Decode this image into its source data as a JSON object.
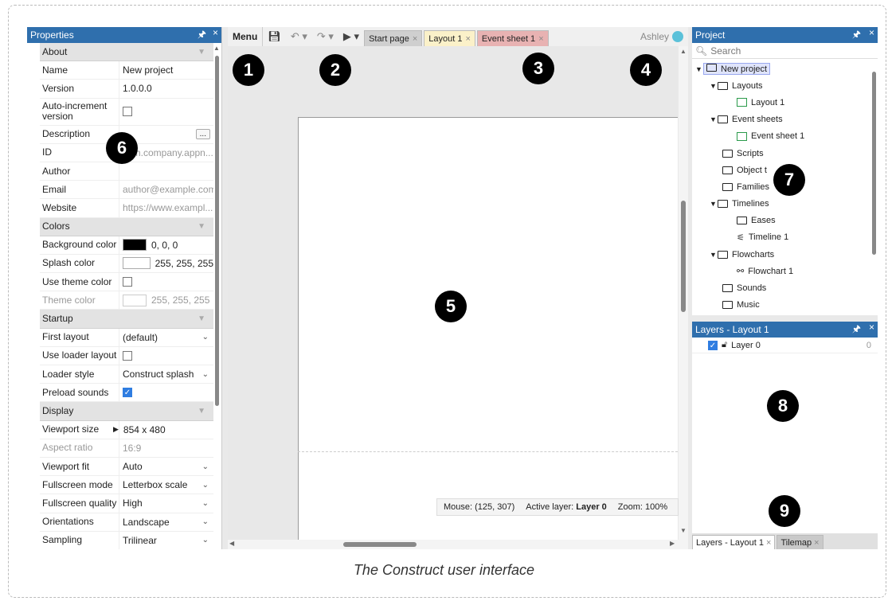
{
  "caption": "The Construct user interface",
  "colors": {
    "titlebar": "#2f6fad",
    "layout_tab": "#fbf1c9",
    "event_tab": "#e8b2b2"
  },
  "properties": {
    "title": "Properties",
    "pin_icon": "pin-icon",
    "close": "×",
    "sections": {
      "about": "About",
      "colors": "Colors",
      "startup": "Startup",
      "display": "Display"
    },
    "about": {
      "name_k": "Name",
      "name_v": "New project",
      "version_k": "Version",
      "version_v": "1.0.0.0",
      "autoinc_k": "Auto-increment version",
      "desc_k": "Description",
      "desc_btn": "...",
      "id_k": "ID",
      "id_v": "com.company.appn...",
      "author_k": "Author",
      "author_v": "",
      "email_k": "Email",
      "email_v": "author@example.com",
      "website_k": "Website",
      "website_v": "https://www.exampl..."
    },
    "colors_sec": {
      "bg_k": "Background color",
      "bg_v": "0, 0, 0",
      "splash_k": "Splash color",
      "splash_v": "255, 255, 255",
      "usetheme_k": "Use theme color",
      "theme_k": "Theme color",
      "theme_v": "255, 255, 255"
    },
    "startup": {
      "first_k": "First layout",
      "first_v": "(default)",
      "useloader_k": "Use loader layout",
      "loaderstyle_k": "Loader style",
      "loaderstyle_v": "Construct splash",
      "preload_k": "Preload sounds"
    },
    "display": {
      "viewport_k": "Viewport size",
      "viewport_v": "854 x 480",
      "aspect_k": "Aspect ratio",
      "aspect_v": "16:9",
      "vfit_k": "Viewport fit",
      "vfit_v": "Auto",
      "fsmode_k": "Fullscreen mode",
      "fsmode_v": "Letterbox scale",
      "fsq_k": "Fullscreen quality",
      "fsq_v": "High",
      "orient_k": "Orientations",
      "orient_v": "Landscape",
      "sampling_k": "Sampling",
      "sampling_v": "Trilinear"
    }
  },
  "toolbar": {
    "menu": "Menu",
    "tabs": [
      "Start page",
      "Layout 1",
      "Event sheet 1"
    ],
    "user": "Ashley"
  },
  "status": {
    "mouse": "Mouse: (125, 307)",
    "active_prefix": "Active layer: ",
    "active_layer": "Layer 0",
    "zoom": "Zoom: 100%"
  },
  "project": {
    "title": "Project",
    "search_placeholder": "Search",
    "items": [
      "New project",
      "Layouts",
      "Layout 1",
      "Event sheets",
      "Event sheet 1",
      "Scripts",
      "Object t",
      "Families",
      "Timelines",
      "Eases",
      "Timeline 1",
      "Flowcharts",
      "Flowchart 1",
      "Sounds",
      "Music"
    ]
  },
  "layers": {
    "title": "Layers - Layout 1",
    "layer_name": "Layer 0",
    "layer_num": "0",
    "tabs": [
      "Layers - Layout 1",
      "Tilemap"
    ]
  },
  "badges": [
    "1",
    "2",
    "3",
    "4",
    "5",
    "6",
    "7",
    "8",
    "9"
  ]
}
